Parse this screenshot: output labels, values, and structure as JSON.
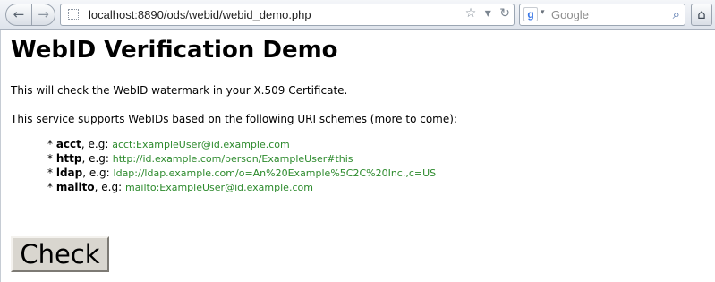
{
  "browser": {
    "back_icon": "←",
    "forward_icon": "→",
    "url": "localhost:8890/ods/webid/webid_demo.php",
    "bookmark_icon": "☆",
    "dropdown_icon": "▾",
    "reload_icon": "↻",
    "search_engine_icon": "g",
    "search_engine_caret": "▾",
    "search_placeholder": "Google",
    "search_icon": "⌕",
    "home_icon": "⌂"
  },
  "page": {
    "title": "WebID Verification Demo",
    "intro": "This will check the WebID watermark in your X.509 Certificate.",
    "schemes_intro": "This service supports WebIDs based on the following URI schemes (more to come):",
    "schemes": [
      {
        "bullet": "* ",
        "name": "acct",
        "eg": ", e.g: ",
        "example": "acct:ExampleUser@id.example.com"
      },
      {
        "bullet": "* ",
        "name": "http",
        "eg": ", e.g: ",
        "example": "http://id.example.com/person/ExampleUser#this"
      },
      {
        "bullet": "* ",
        "name": "ldap",
        "eg": ", e.g: ",
        "example": "ldap://ldap.example.com/o=An%20Example%5C2C%20Inc.,c=US"
      },
      {
        "bullet": "* ",
        "name": "mailto",
        "eg": ", e.g: ",
        "example": "mailto:ExampleUser@id.example.com"
      }
    ],
    "check_label": "Check"
  }
}
